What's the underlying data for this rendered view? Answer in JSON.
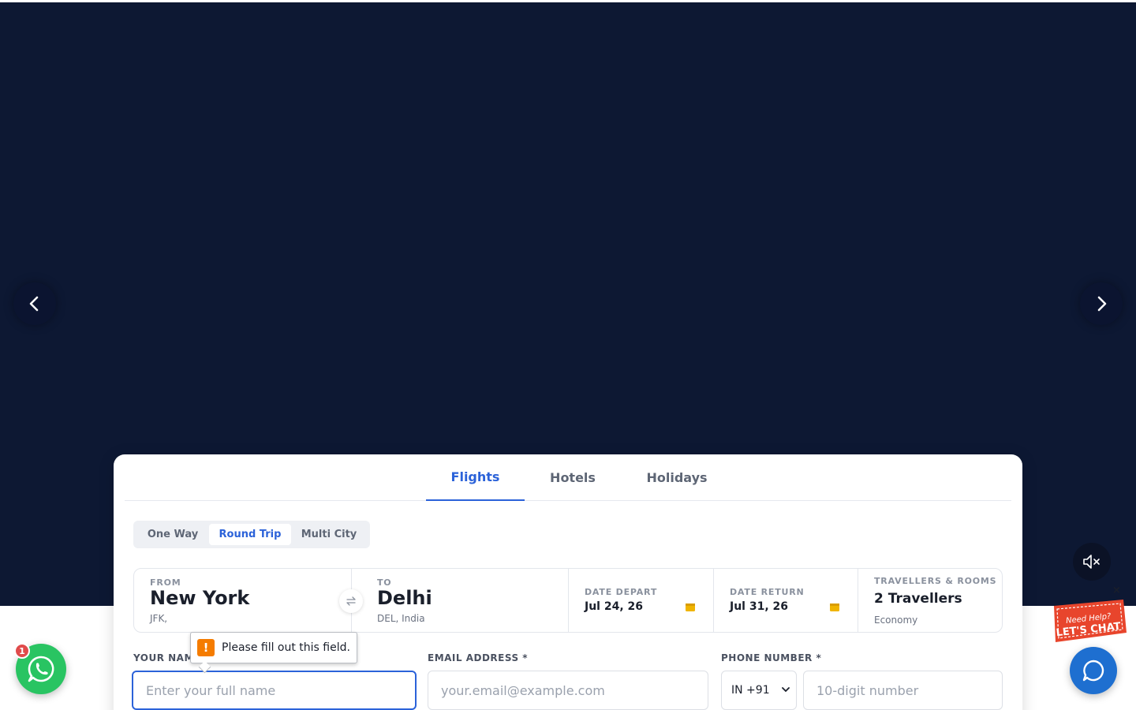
{
  "colors": {
    "hero_bg": "#0d1833",
    "accent": "#2b62d9",
    "whatsapp": "#29c462",
    "chat": "#1e6fd0",
    "warning": "#f57c00",
    "calendar": "#f0b400"
  },
  "carousel": {
    "prev_icon": "chevron-left-icon",
    "next_icon": "chevron-right-icon",
    "mute_icon": "speaker-muted-icon"
  },
  "tabs": [
    {
      "label": "Flights",
      "active": true
    },
    {
      "label": "Hotels",
      "active": false
    },
    {
      "label": "Holidays",
      "active": false
    }
  ],
  "trip_types": [
    {
      "label": "One Way",
      "active": false
    },
    {
      "label": "Round Trip",
      "active": true
    },
    {
      "label": "Multi City",
      "active": false
    }
  ],
  "search": {
    "from": {
      "label": "FROM",
      "city": "New York",
      "detail": "JFK,"
    },
    "to": {
      "label": "TO",
      "city": "Delhi",
      "detail": "DEL, India"
    },
    "depart": {
      "label": "DATE DEPART",
      "value": "Jul 24, 26"
    },
    "return": {
      "label": "DATE RETURN",
      "value": "Jul 31, 26"
    },
    "travellers": {
      "label": "TRAVELLERS & ROOMS",
      "value": "2 Travellers",
      "cabin": "Economy"
    }
  },
  "form": {
    "name": {
      "label": "YOUR NAME *",
      "placeholder": "Enter your full name"
    },
    "email": {
      "label": "EMAIL ADDRESS *",
      "placeholder": "your.email@example.com"
    },
    "phone": {
      "label": "PHONE NUMBER *",
      "country_code": "IN +91",
      "placeholder": "10-digit number"
    }
  },
  "validation": {
    "icon": "!",
    "message": "Please fill out this field."
  },
  "widgets": {
    "whatsapp_badge": "1",
    "chat_ribbon_top": "Need Help?",
    "chat_ribbon_bottom": "LET'S CHAT",
    "chat_close": "×"
  }
}
